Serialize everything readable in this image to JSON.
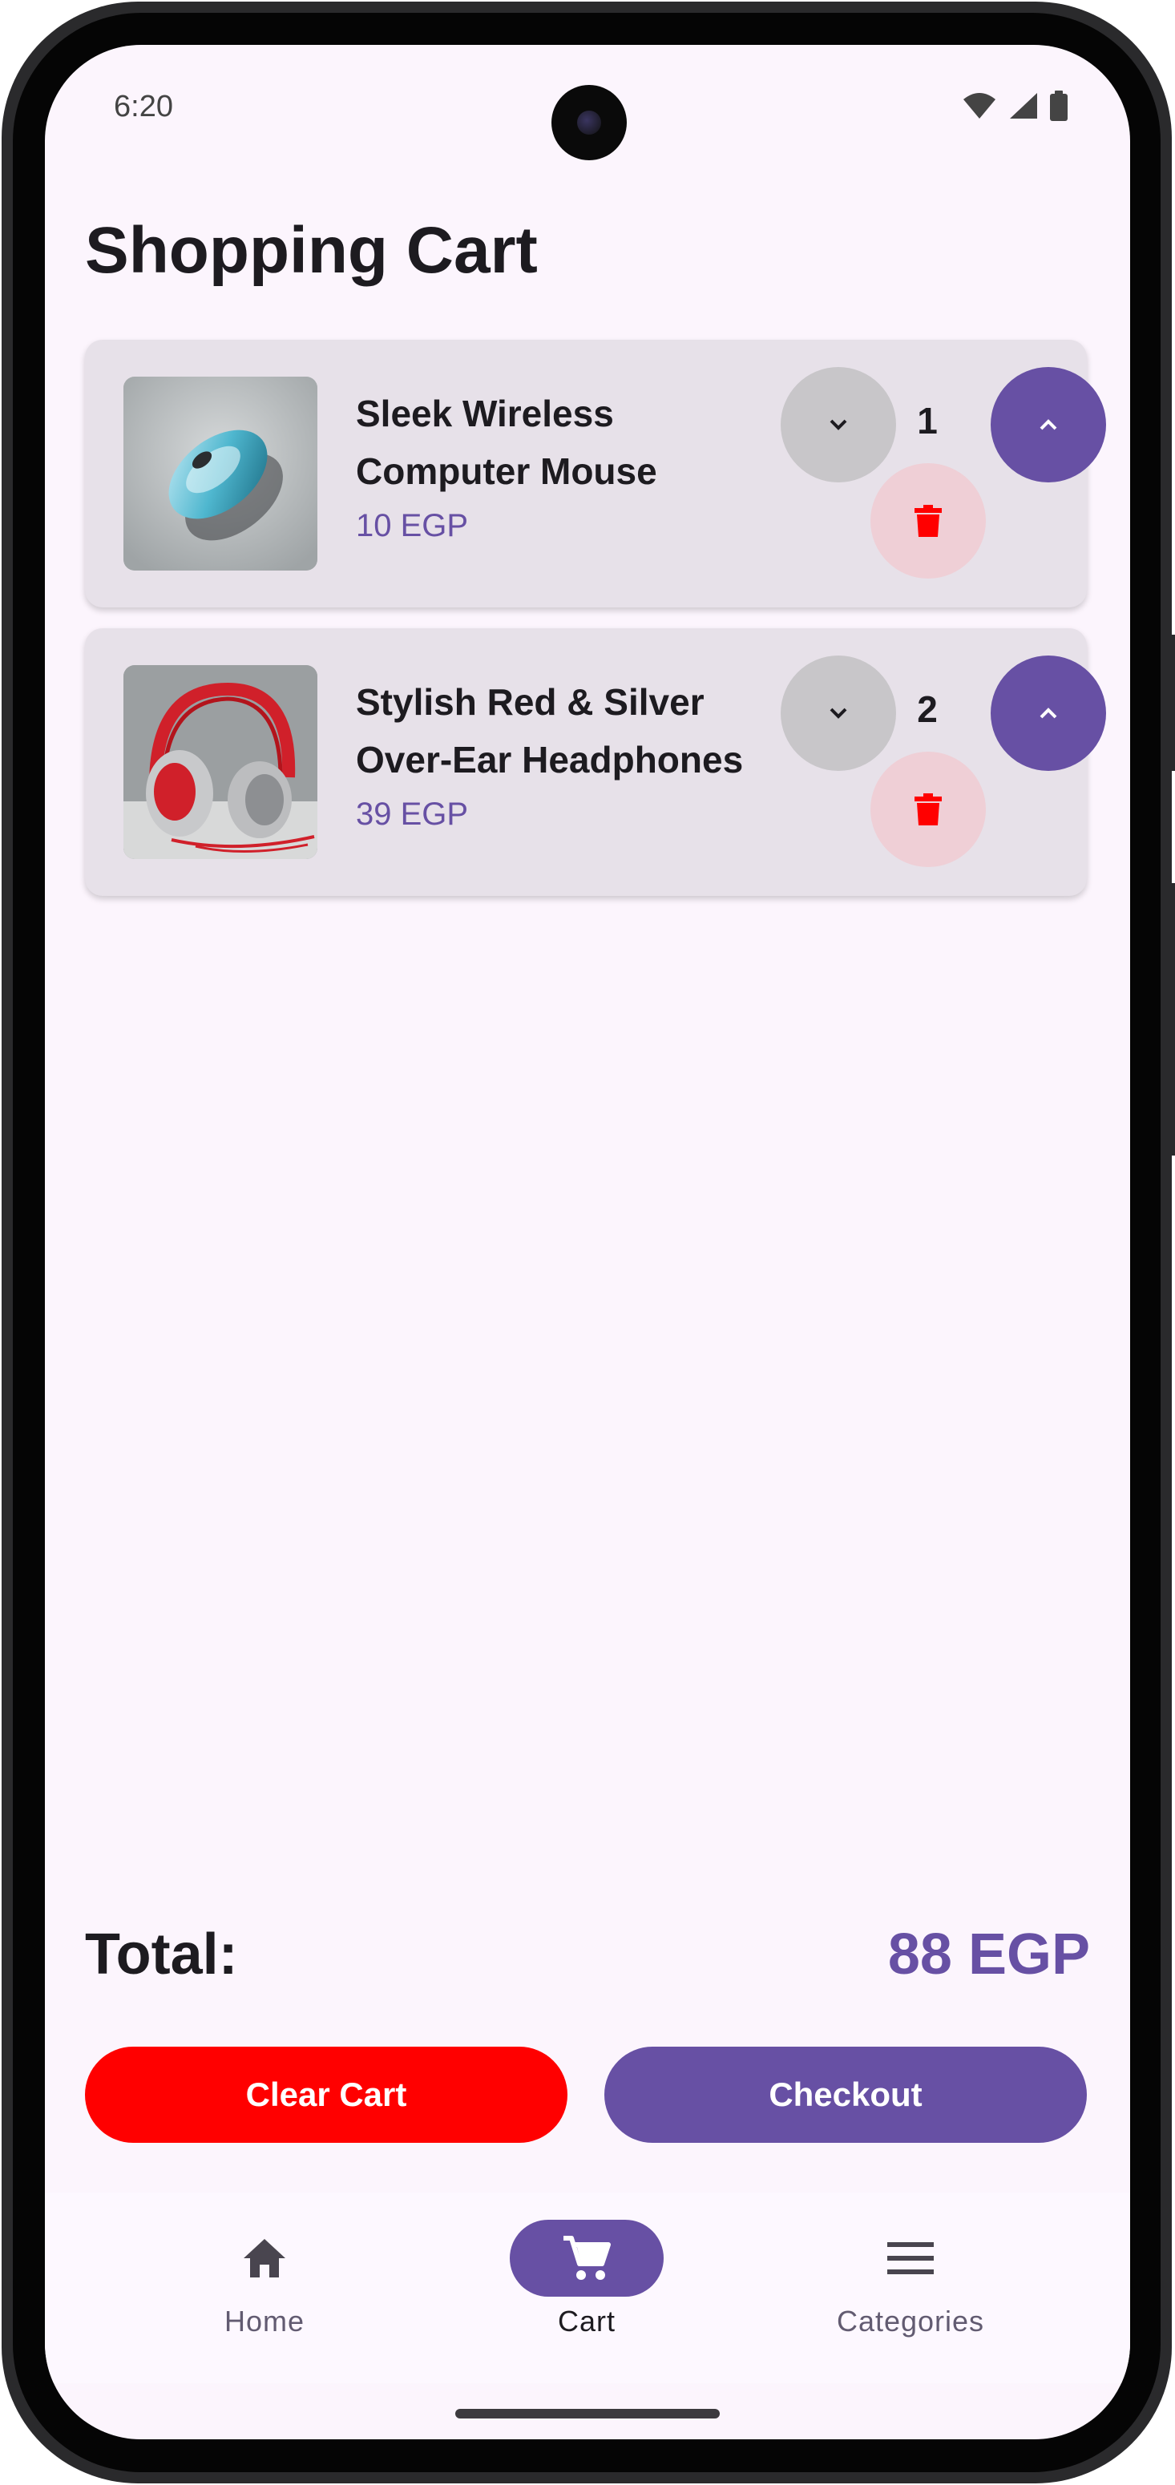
{
  "status_bar": {
    "time": "6:20"
  },
  "page": {
    "title": "Shopping Cart"
  },
  "cart": {
    "items": [
      {
        "name": "Sleek Wireless Computer Mouse",
        "price": "10 EGP",
        "quantity": "1",
        "image": "wireless-mouse"
      },
      {
        "name": "Stylish Red & Silver Over-Ear Headphones",
        "price": "39 EGP",
        "quantity": "2",
        "image": "headphones"
      }
    ]
  },
  "summary": {
    "total_label": "Total:",
    "total_value": "88 EGP"
  },
  "actions": {
    "clear_label": "Clear Cart",
    "checkout_label": "Checkout"
  },
  "nav": {
    "items": [
      {
        "label": "Home",
        "icon": "home-icon",
        "active": false
      },
      {
        "label": "Cart",
        "icon": "cart-icon",
        "active": true
      },
      {
        "label": "Categories",
        "icon": "menu-icon",
        "active": false
      }
    ]
  },
  "colors": {
    "primary": "#6750a4",
    "danger": "#ff0000",
    "background": "#fcf5fd",
    "card": "#e7e1e9",
    "delete_bg": "#efcfd6"
  }
}
